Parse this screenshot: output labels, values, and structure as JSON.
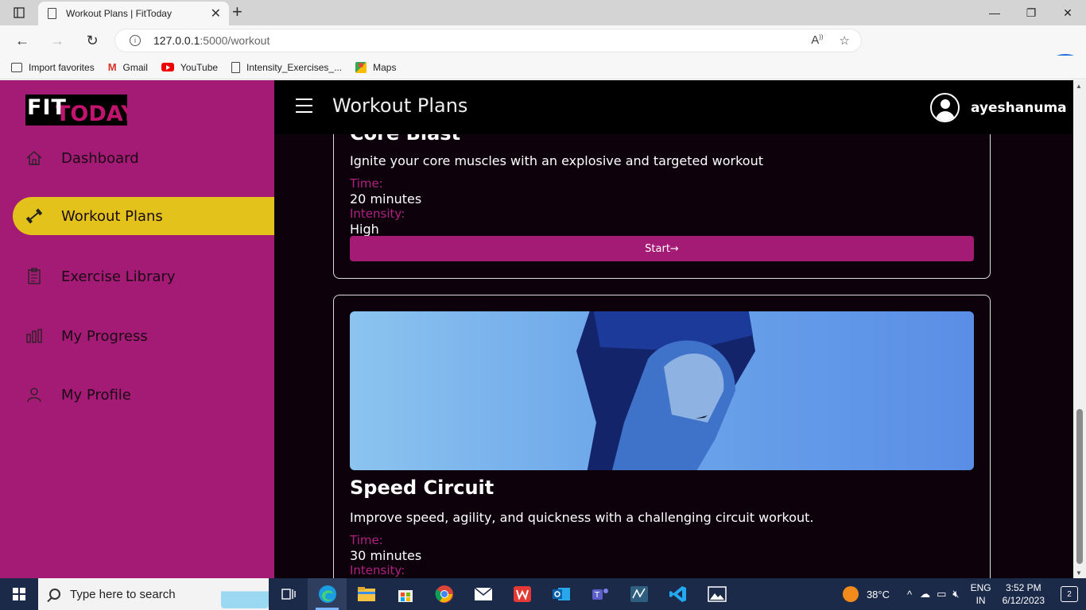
{
  "browser": {
    "tab_title": "Workout Plans | FitToday",
    "url_host": "127.0.0.1",
    "url_rest": ":5000/workout",
    "favorites": [
      {
        "label": "Import favorites",
        "icon": "import-icon"
      },
      {
        "label": "Gmail",
        "icon": "gmail-icon"
      },
      {
        "label": "YouTube",
        "icon": "youtube-icon"
      },
      {
        "label": "Intensity_Exercises_...",
        "icon": "document-icon"
      },
      {
        "label": "Maps",
        "icon": "maps-icon"
      }
    ]
  },
  "sidebar": {
    "logo_fit": "FIT",
    "logo_today": "TODAY",
    "items": [
      {
        "label": "Dashboard",
        "icon": "home-icon",
        "active": false
      },
      {
        "label": "Workout Plans",
        "icon": "dumbbell-icon",
        "active": true
      },
      {
        "label": "Exercise Library",
        "icon": "clipboard-icon",
        "active": false
      },
      {
        "label": "My Progress",
        "icon": "bar-chart-icon",
        "active": false
      },
      {
        "label": "My Profile",
        "icon": "user-icon",
        "active": false
      }
    ]
  },
  "header": {
    "title": "Workout Plans",
    "username": "ayeshanuma"
  },
  "workouts": [
    {
      "title": "Core Blast",
      "description": "Ignite your core muscles with an explosive and targeted workout",
      "time_label": "Time:",
      "time": "20 minutes",
      "intensity_label": "Intensity:",
      "intensity": "High",
      "button": "Start→"
    },
    {
      "title": "Speed Circuit",
      "description": "Improve speed, agility, and quickness with a challenging circuit workout.",
      "time_label": "Time:",
      "time": "30 minutes",
      "intensity_label": "Intensity:"
    }
  ],
  "taskbar": {
    "search_placeholder": "Type here to search",
    "temperature": "38°C",
    "lang1": "ENG",
    "lang2": "IN",
    "time": "3:52 PM",
    "date": "6/12/2023",
    "notifications": "2"
  },
  "colors": {
    "sidebar": "#a41b76",
    "active_item": "#e3c21b",
    "main_bg": "#0d020c",
    "accent": "#a41b76"
  }
}
